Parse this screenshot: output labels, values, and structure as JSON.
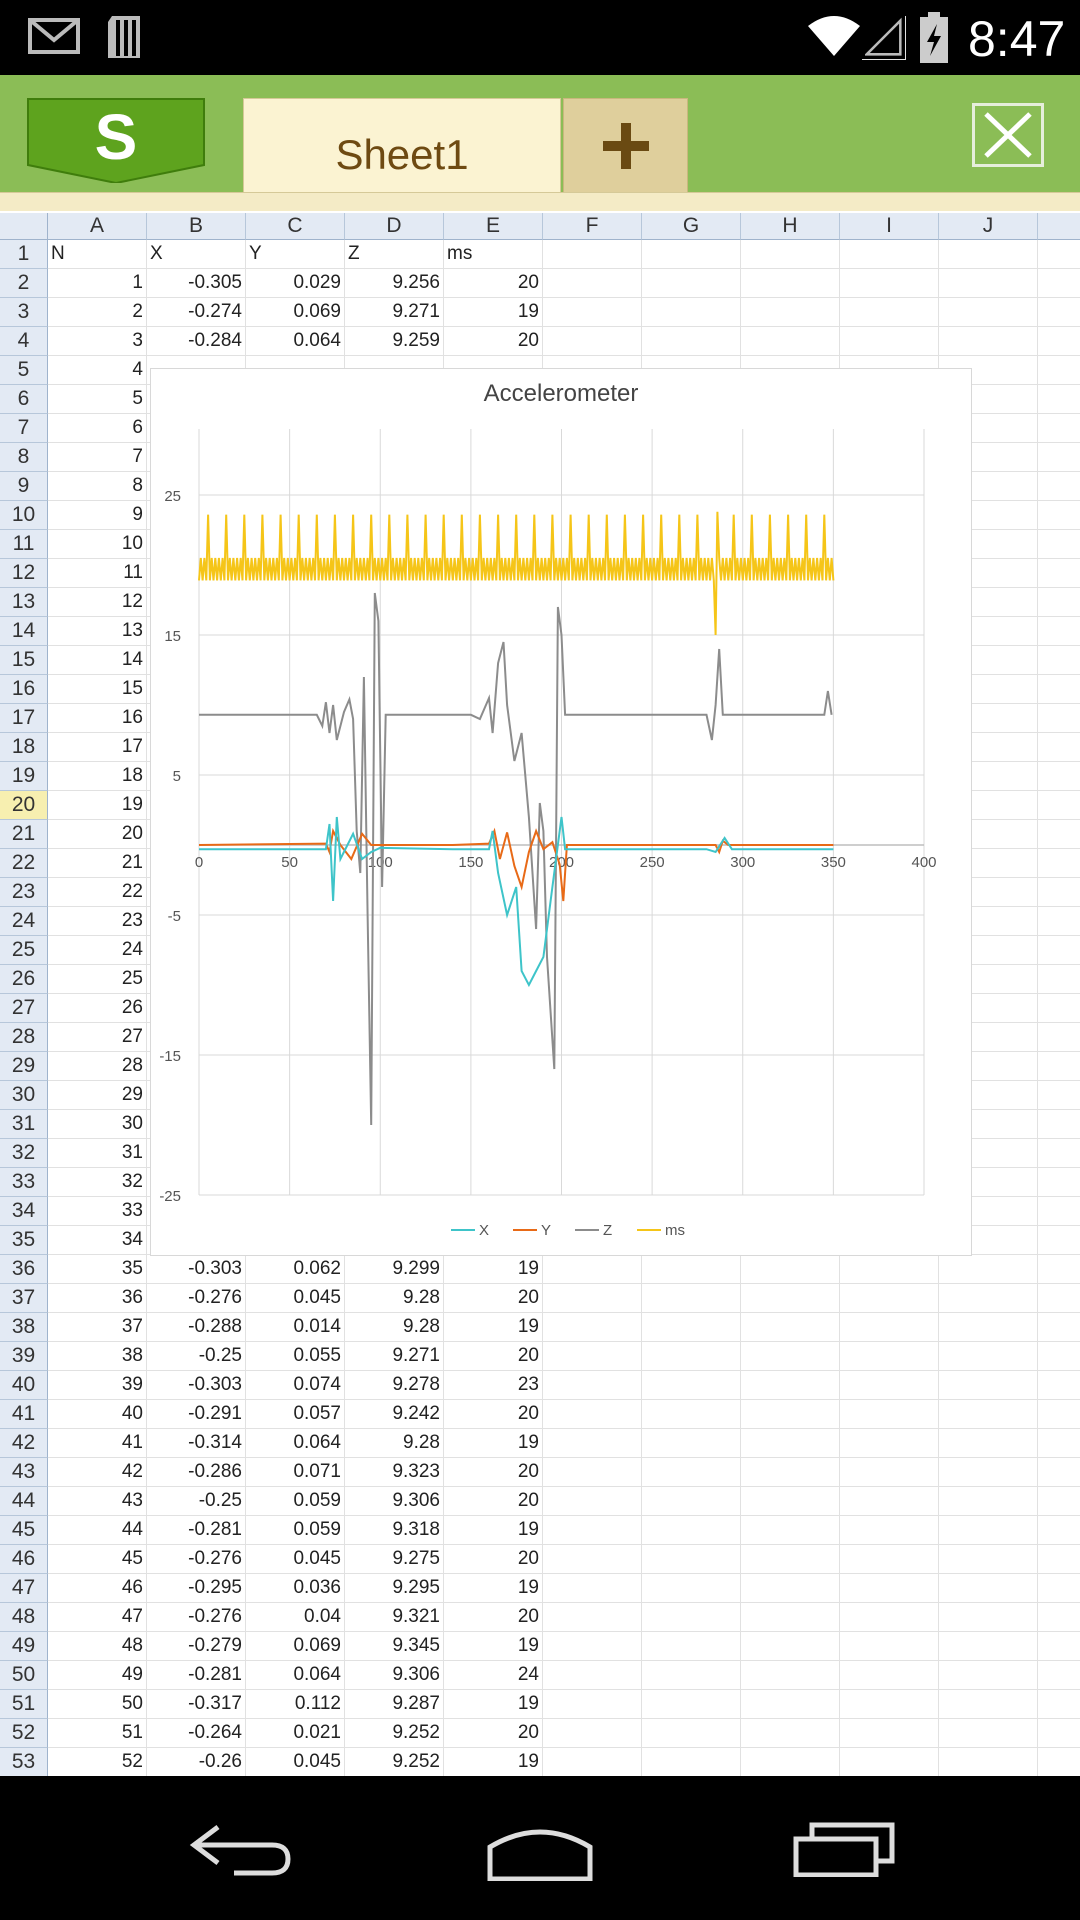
{
  "status_bar": {
    "time": "8:47"
  },
  "app": {
    "logo_letter": "S",
    "sheet_tab": "Sheet1",
    "add_tab": "+"
  },
  "columns": [
    "A",
    "B",
    "C",
    "D",
    "E",
    "F",
    "G",
    "H",
    "I",
    "J"
  ],
  "selected_row": 20,
  "rows": [
    [
      "N",
      "X",
      "Y",
      "Z",
      "ms"
    ],
    [
      "1",
      "-0.305",
      "0.029",
      "9.256",
      "20"
    ],
    [
      "2",
      "-0.274",
      "0.069",
      "9.271",
      "19"
    ],
    [
      "3",
      "-0.284",
      "0.064",
      "9.259",
      "20"
    ],
    [
      "4",
      "",
      "",
      "",
      ""
    ],
    [
      "5",
      "",
      "",
      "",
      ""
    ],
    [
      "6",
      "",
      "",
      "",
      ""
    ],
    [
      "7",
      "",
      "",
      "",
      ""
    ],
    [
      "8",
      "",
      "",
      "",
      ""
    ],
    [
      "9",
      "",
      "",
      "",
      ""
    ],
    [
      "10",
      "",
      "",
      "",
      ""
    ],
    [
      "11",
      "",
      "",
      "",
      ""
    ],
    [
      "12",
      "",
      "",
      "",
      ""
    ],
    [
      "13",
      "",
      "",
      "",
      ""
    ],
    [
      "14",
      "",
      "",
      "",
      ""
    ],
    [
      "15",
      "",
      "",
      "",
      ""
    ],
    [
      "16",
      "",
      "",
      "",
      ""
    ],
    [
      "17",
      "",
      "",
      "",
      ""
    ],
    [
      "18",
      "",
      "",
      "",
      ""
    ],
    [
      "19",
      "",
      "",
      "",
      ""
    ],
    [
      "20",
      "",
      "",
      "",
      ""
    ],
    [
      "21",
      "",
      "",
      "",
      ""
    ],
    [
      "22",
      "",
      "",
      "",
      ""
    ],
    [
      "23",
      "",
      "",
      "",
      ""
    ],
    [
      "24",
      "",
      "",
      "",
      ""
    ],
    [
      "25",
      "",
      "",
      "",
      ""
    ],
    [
      "26",
      "",
      "",
      "",
      ""
    ],
    [
      "27",
      "",
      "",
      "",
      ""
    ],
    [
      "28",
      "",
      "",
      "",
      ""
    ],
    [
      "29",
      "",
      "",
      "",
      ""
    ],
    [
      "30",
      "",
      "",
      "",
      ""
    ],
    [
      "31",
      "",
      "",
      "",
      ""
    ],
    [
      "32",
      "",
      "",
      "",
      ""
    ],
    [
      "33",
      "",
      "",
      "",
      ""
    ],
    [
      "34",
      "",
      "",
      "",
      ""
    ],
    [
      "35",
      "-0.303",
      "0.062",
      "9.299",
      "19"
    ],
    [
      "36",
      "-0.276",
      "0.045",
      "9.28",
      "20"
    ],
    [
      "37",
      "-0.288",
      "0.014",
      "9.28",
      "19"
    ],
    [
      "38",
      "-0.25",
      "0.055",
      "9.271",
      "20"
    ],
    [
      "39",
      "-0.303",
      "0.074",
      "9.278",
      "23"
    ],
    [
      "40",
      "-0.291",
      "0.057",
      "9.242",
      "20"
    ],
    [
      "41",
      "-0.314",
      "0.064",
      "9.28",
      "19"
    ],
    [
      "42",
      "-0.286",
      "0.071",
      "9.323",
      "20"
    ],
    [
      "43",
      "-0.25",
      "0.059",
      "9.306",
      "20"
    ],
    [
      "44",
      "-0.281",
      "0.059",
      "9.318",
      "19"
    ],
    [
      "45",
      "-0.276",
      "0.045",
      "9.275",
      "20"
    ],
    [
      "46",
      "-0.295",
      "0.036",
      "9.295",
      "19"
    ],
    [
      "47",
      "-0.276",
      "0.04",
      "9.321",
      "20"
    ],
    [
      "48",
      "-0.279",
      "0.069",
      "9.345",
      "19"
    ],
    [
      "49",
      "-0.281",
      "0.064",
      "9.306",
      "24"
    ],
    [
      "50",
      "-0.317",
      "0.112",
      "9.287",
      "19"
    ],
    [
      "51",
      "-0.264",
      "0.021",
      "9.252",
      "20"
    ],
    [
      "52",
      "-0.26",
      "0.045",
      "9.252",
      "19"
    ]
  ],
  "chart_data": {
    "type": "line",
    "title": "Accelerometer",
    "xlim": [
      0,
      400
    ],
    "ylim": [
      -25,
      25
    ],
    "x_ticks": [
      0,
      50,
      100,
      150,
      200,
      250,
      300,
      350,
      400
    ],
    "y_ticks": [
      25,
      15,
      5,
      -5,
      -15,
      -25
    ],
    "grid": true,
    "legend_position": "bottom",
    "series": [
      {
        "name": "X",
        "color": "#3ec4c9",
        "points": [
          [
            0,
            -0.3
          ],
          [
            70,
            -0.3
          ],
          [
            72,
            1.5
          ],
          [
            74,
            -4
          ],
          [
            76,
            2
          ],
          [
            78,
            -1
          ],
          [
            85,
            0.8
          ],
          [
            90,
            -1
          ],
          [
            95,
            -0.5
          ],
          [
            100,
            -0.2
          ],
          [
            140,
            -0.3
          ],
          [
            160,
            -0.3
          ],
          [
            162,
            1
          ],
          [
            165,
            -2
          ],
          [
            170,
            -5
          ],
          [
            175,
            -3
          ],
          [
            178,
            -9
          ],
          [
            182,
            -10
          ],
          [
            186,
            -9
          ],
          [
            190,
            -8
          ],
          [
            195,
            -3
          ],
          [
            200,
            2
          ],
          [
            202,
            -0.3
          ],
          [
            250,
            -0.3
          ],
          [
            280,
            -0.3
          ],
          [
            285,
            -0.5
          ],
          [
            290,
            0.5
          ],
          [
            294,
            -0.3
          ],
          [
            350,
            -0.3
          ]
        ]
      },
      {
        "name": "Y",
        "color": "#e86a17",
        "points": [
          [
            0,
            0
          ],
          [
            70,
            0.1
          ],
          [
            72,
            -0.5
          ],
          [
            74,
            1
          ],
          [
            78,
            0
          ],
          [
            84,
            -1
          ],
          [
            90,
            0.8
          ],
          [
            95,
            0
          ],
          [
            140,
            0
          ],
          [
            160,
            0.1
          ],
          [
            163,
            1
          ],
          [
            166,
            -1
          ],
          [
            170,
            0.9
          ],
          [
            174,
            -1.5
          ],
          [
            178,
            -3
          ],
          [
            182,
            -0.5
          ],
          [
            186,
            1
          ],
          [
            190,
            -0.3
          ],
          [
            195,
            0.2
          ],
          [
            199,
            -1.4
          ],
          [
            201,
            -4
          ],
          [
            203,
            0
          ],
          [
            250,
            0
          ],
          [
            285,
            0
          ],
          [
            287,
            -0.5
          ],
          [
            289,
            0.3
          ],
          [
            292,
            0
          ],
          [
            350,
            0
          ]
        ]
      },
      {
        "name": "Z",
        "color": "#8c8c8c",
        "points": [
          [
            0,
            9.3
          ],
          [
            65,
            9.3
          ],
          [
            68,
            8.5
          ],
          [
            70,
            10.2
          ],
          [
            72,
            8
          ],
          [
            74,
            10
          ],
          [
            76,
            7.5
          ],
          [
            80,
            9.5
          ],
          [
            83,
            10.4
          ],
          [
            85,
            9
          ],
          [
            87,
            1
          ],
          [
            89,
            -2
          ],
          [
            91,
            12
          ],
          [
            93,
            -5
          ],
          [
            95,
            -20
          ],
          [
            97,
            18
          ],
          [
            99,
            16
          ],
          [
            101,
            -3
          ],
          [
            103,
            9.3
          ],
          [
            150,
            9.3
          ],
          [
            155,
            9
          ],
          [
            160,
            10.5
          ],
          [
            162,
            8
          ],
          [
            165,
            13
          ],
          [
            168,
            14.5
          ],
          [
            170,
            10
          ],
          [
            174,
            6
          ],
          [
            178,
            8
          ],
          [
            182,
            2
          ],
          [
            186,
            -6
          ],
          [
            188,
            3
          ],
          [
            190,
            1
          ],
          [
            192,
            -8
          ],
          [
            196,
            -16
          ],
          [
            198,
            17
          ],
          [
            200,
            15
          ],
          [
            202,
            9.3
          ],
          [
            240,
            9.3
          ],
          [
            280,
            9.3
          ],
          [
            283,
            7.5
          ],
          [
            285,
            10
          ],
          [
            287,
            14
          ],
          [
            289,
            9.3
          ],
          [
            330,
            9.3
          ],
          [
            345,
            9.3
          ],
          [
            347,
            11
          ],
          [
            349,
            9.3
          ]
        ]
      },
      {
        "name": "ms",
        "color": "#f5c518",
        "points": []
      }
    ]
  }
}
